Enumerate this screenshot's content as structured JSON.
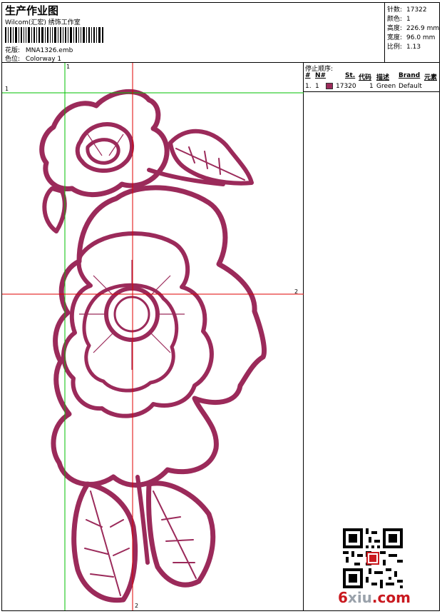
{
  "header": {
    "title": "生产作业图",
    "company": "Wilcom(汇宏) 绣饰工作室",
    "design_label": "花版:",
    "design_value": "MNA1326.emb",
    "colorway_label": "色位:",
    "colorway_value": "Colorway 1"
  },
  "specs": [
    {
      "label": "针数:",
      "value": "17322"
    },
    {
      "label": "颜色:",
      "value": "1"
    },
    {
      "label": "高度:",
      "value": "226.9 mm"
    },
    {
      "label": "宽度:",
      "value": "96.0 mm"
    },
    {
      "label": "比例:",
      "value": "1.13"
    }
  ],
  "stop_sequence": {
    "title": "停止顺序:",
    "headers": [
      "#",
      "N#",
      "St.",
      "代码",
      "描述",
      "Brand",
      "元素"
    ],
    "rows": [
      {
        "num": "1.",
        "n": "1",
        "stitches": "17320",
        "code": "1",
        "description": "Green",
        "brand": "Default",
        "swatch": "#9b2a5a"
      }
    ]
  },
  "guides": {
    "h1": "1",
    "v1": "1",
    "h2": "2",
    "v2": "2",
    "colors": {
      "green": "#00c000",
      "red": "#e00000"
    }
  },
  "thread_color": "#9b2a5a",
  "watermark": {
    "part1": "6",
    "part2": "xiu",
    "part3": ".com"
  }
}
